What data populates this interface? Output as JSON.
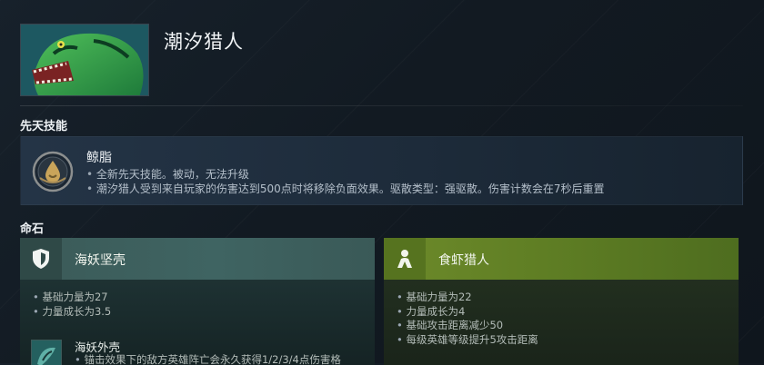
{
  "hero": {
    "name": "潮汐猎人"
  },
  "sections": {
    "innate": "先天技能",
    "facets": "命石"
  },
  "innate": {
    "name": "鲸脂",
    "lines": [
      "全新先天技能。被动，无法升级",
      "潮汐猎人受到来自玩家的伤害达到500点时将移除负面效果。驱散类型：强驱散。伤害计数会在7秒后重置"
    ],
    "icon": "droplet-emblem-icon"
  },
  "facets": [
    {
      "title": "海妖坚壳",
      "icon": "shield-icon",
      "color": "#3f6462",
      "bullets": [
        "基础力量为27",
        "力量成长为3.5"
      ],
      "subability": {
        "name": "海妖外壳",
        "line": "锚击效果下的敌方英雄阵亡会永久获得1/2/3/4点伤害格",
        "icon": "kraken-shell-icon"
      }
    },
    {
      "title": "食虾猎人",
      "icon": "hunter-figure-icon",
      "color": "#6d8a2a",
      "bullets": [
        "基础力量为22",
        "力量成长为4",
        "基础攻击距离减少50",
        "每级英雄等级提升5攻击距离"
      ]
    }
  ]
}
